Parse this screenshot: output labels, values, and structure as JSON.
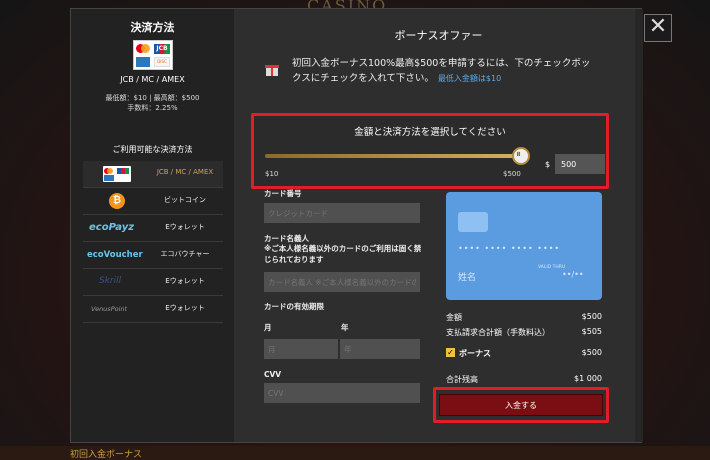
{
  "background": {
    "logo_text": "CASINO"
  },
  "close_label": "✕",
  "left_panel": {
    "title": "決済方法",
    "card_brands": "JCB / MC / AMEX",
    "limits": "最低額：$10 | 最高額：$500",
    "fee": "手数料：2.25%",
    "available_title": "ご利用可能な決済方法",
    "methods": [
      {
        "label": "JCB / MC / AMEX",
        "logo": "card-brands-icon"
      },
      {
        "label": "ビットコイン",
        "logo": "bitcoin-icon"
      },
      {
        "label": "Eウォレット",
        "logo_text": "ecoPayz"
      },
      {
        "label": "エコバウチャー",
        "logo_text": "ecoVoucher"
      },
      {
        "label": "Eウォレット",
        "logo_text": "Skrill"
      },
      {
        "label": "Eウォレット",
        "logo_text": "VenusPoint"
      }
    ]
  },
  "right_panel": {
    "title": "ボーナスオファー",
    "bonus_text": "初回入金ボーナス100%最高$500を申請するには、下のチェックボックスにチェックを入れて下さい。",
    "min_deposit_text": "最低入金額は$10",
    "selector": {
      "title": "金額と決済方法を選択してください",
      "min_label": "$10",
      "max_label": "$500",
      "currency": "$",
      "amount": "500",
      "slider_fraction": 1.0
    },
    "form": {
      "card_number_label": "カード番号",
      "card_number_placeholder": "クレジットカード",
      "holder_label": "カード名義人",
      "holder_note": "※ご本人様名義以外のカードのご利用は固く禁じられております",
      "holder_placeholder": "カード名義人 ※ご本人様名義以外のカードのご",
      "expiry_label": "カードの有効期限",
      "month_label": "月",
      "year_label": "年",
      "month_placeholder": "月",
      "year_placeholder": "年",
      "cvv_label": "CVV",
      "cvv_placeholder": "CVV"
    },
    "card_preview": {
      "number_mask": "•••• •••• •••• ••••",
      "holder_text": "姓名",
      "valid_label": "VALID THRU",
      "expiry_mask": "••/••"
    },
    "summary": {
      "amount_label": "金額",
      "amount_value": "$500",
      "total_charge_label": "支払請求合計額（手数料込）",
      "total_charge_value": "$505",
      "bonus_label": "ボーナス",
      "bonus_value": "$500",
      "bonus_checked": true,
      "balance_label": "合計残高",
      "balance_value": "$1 000"
    },
    "deposit_label": "入金する"
  },
  "colors": {
    "highlight": "#e31d28",
    "accent": "#c8a35a",
    "button": "#7a0e12",
    "card": "#5b9be0"
  },
  "footer_text": "初回入金ボーナス"
}
